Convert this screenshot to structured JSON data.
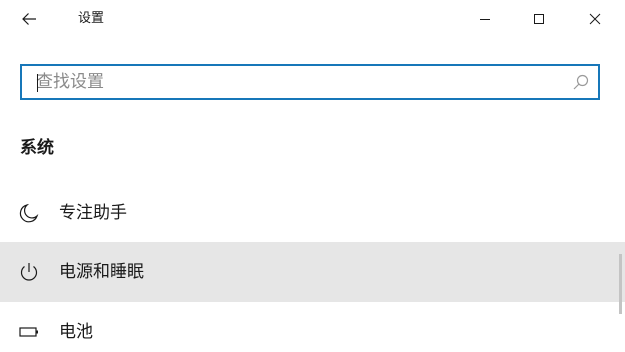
{
  "window": {
    "title": "设置",
    "controls": {
      "back_icon": "arrow-left-icon",
      "minimize_icon": "minimize-icon",
      "maximize_icon": "maximize-icon",
      "close_icon": "close-icon"
    }
  },
  "search": {
    "placeholder": "查找设置",
    "value": "",
    "icon": "search-icon",
    "accent_color": "#1777b9"
  },
  "section": {
    "title": "系统"
  },
  "nav": {
    "items": [
      {
        "label": "专注助手",
        "icon": "moon-icon",
        "selected": false
      },
      {
        "label": "电源和睡眠",
        "icon": "power-icon",
        "selected": true
      },
      {
        "label": "电池",
        "icon": "battery-icon",
        "selected": false
      }
    ]
  },
  "colors": {
    "selected_background": "#e6e6e6",
    "text": "#1a1a1a"
  }
}
